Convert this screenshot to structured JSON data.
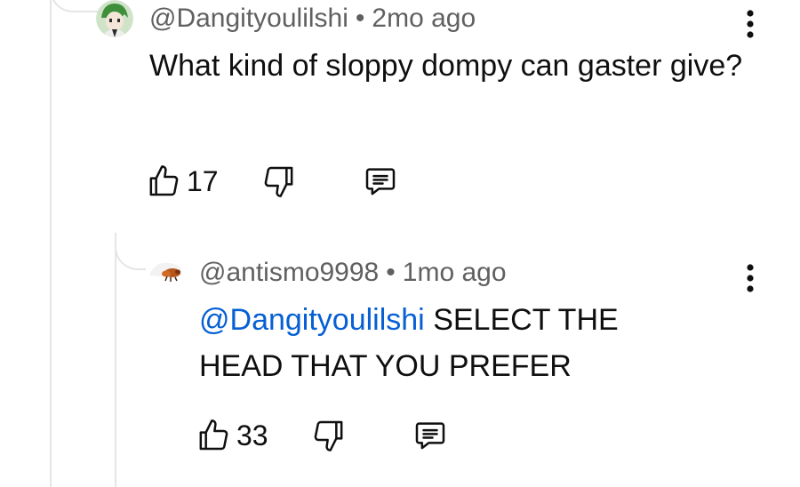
{
  "comment": {
    "author": "@Dangityoulilshi",
    "separator": "•",
    "time": "2mo ago",
    "text": "What kind of sloppy dompy can gaster give?",
    "likes": "17"
  },
  "reply": {
    "author": "@antismo9998",
    "separator": "•",
    "time": "1mo ago",
    "mention": "@Dangityoulilshi",
    "text": "SELECT THE HEAD THAT YOU PREFER",
    "likes": "33"
  },
  "icons": {
    "like": "thumbs-up-icon",
    "dislike": "thumbs-down-icon",
    "reply": "comment-icon",
    "menu": "more-vertical-icon"
  },
  "colors": {
    "text": "#0f0f0f",
    "meta": "#606060",
    "mention": "#065fd4",
    "thread": "#e5e5e5"
  }
}
